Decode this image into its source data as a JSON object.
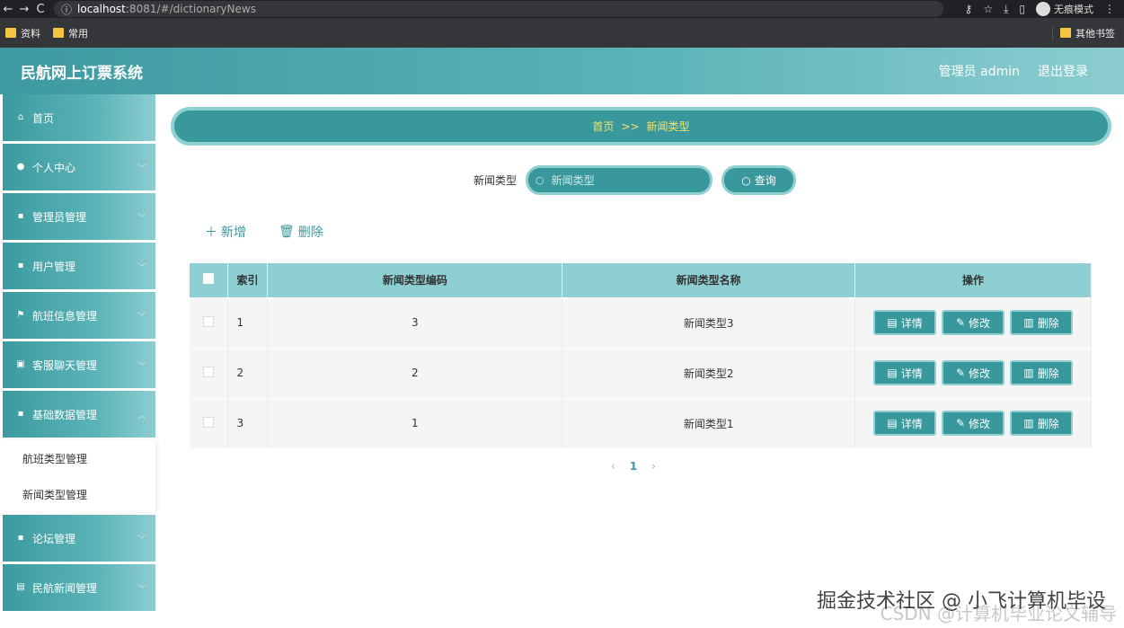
{
  "browser": {
    "back": "←",
    "forward": "→",
    "reload": "C",
    "info": "ⓘ",
    "url_host": "localhost",
    "url_path": ":8081/#/dictionaryNews",
    "incognito": "无痕模式",
    "menu": "⋮",
    "bookmarks": [
      "资料",
      "常用"
    ],
    "other_bookmarks": "其他书签"
  },
  "header": {
    "title": "民航网上订票系统",
    "user": "管理员 admin",
    "logout": "退出登录"
  },
  "sidebar": {
    "items": [
      {
        "label": "首页",
        "icon": "home-icon",
        "glyph": "⌂"
      },
      {
        "label": "个人中心",
        "icon": "user-icon",
        "glyph": "●"
      },
      {
        "label": "管理员管理",
        "icon": "grid-icon",
        "glyph": "▪"
      },
      {
        "label": "用户管理",
        "icon": "grid-icon",
        "glyph": "▪"
      },
      {
        "label": "航班信息管理",
        "icon": "flag-icon",
        "glyph": "⚑"
      },
      {
        "label": "客服聊天管理",
        "icon": "clipboard-icon",
        "glyph": "▣"
      },
      {
        "label": "基础数据管理",
        "icon": "grid-icon",
        "glyph": "▪"
      }
    ],
    "submenu": [
      "航班类型管理",
      "新闻类型管理"
    ],
    "items_after": [
      {
        "label": "论坛管理",
        "icon": "grid-icon",
        "glyph": "▪"
      },
      {
        "label": "民航新闻管理",
        "icon": "document-icon",
        "glyph": "▤"
      }
    ]
  },
  "breadcrumb": {
    "home": "首页",
    "sep": ">>",
    "current": "新闻类型"
  },
  "search": {
    "label": "新闻类型",
    "placeholder": "新闻类型",
    "button": "查询"
  },
  "actions": {
    "add": "新增",
    "delete": "删除"
  },
  "table": {
    "headers": [
      "索引",
      "新闻类型编码",
      "新闻类型名称",
      "操作"
    ],
    "rows": [
      {
        "index": "1",
        "code": "3",
        "name": "新闻类型3"
      },
      {
        "index": "2",
        "code": "2",
        "name": "新闻类型2"
      },
      {
        "index": "3",
        "code": "1",
        "name": "新闻类型1"
      }
    ],
    "ops": {
      "detail": "详情",
      "edit": "修改",
      "delete": "删除"
    }
  },
  "pagination": {
    "prev": "‹",
    "current": "1",
    "next": "›"
  },
  "watermark": {
    "line1": "掘金技术社区 @ 小飞计算机毕设",
    "line2": "CSDN @计算机毕业论文辅导"
  },
  "colors": {
    "primary": "#39989c",
    "border": "#8fd0d2",
    "header_th": "#8ecfd3",
    "breadcrumb_text": "#f8e06a"
  }
}
